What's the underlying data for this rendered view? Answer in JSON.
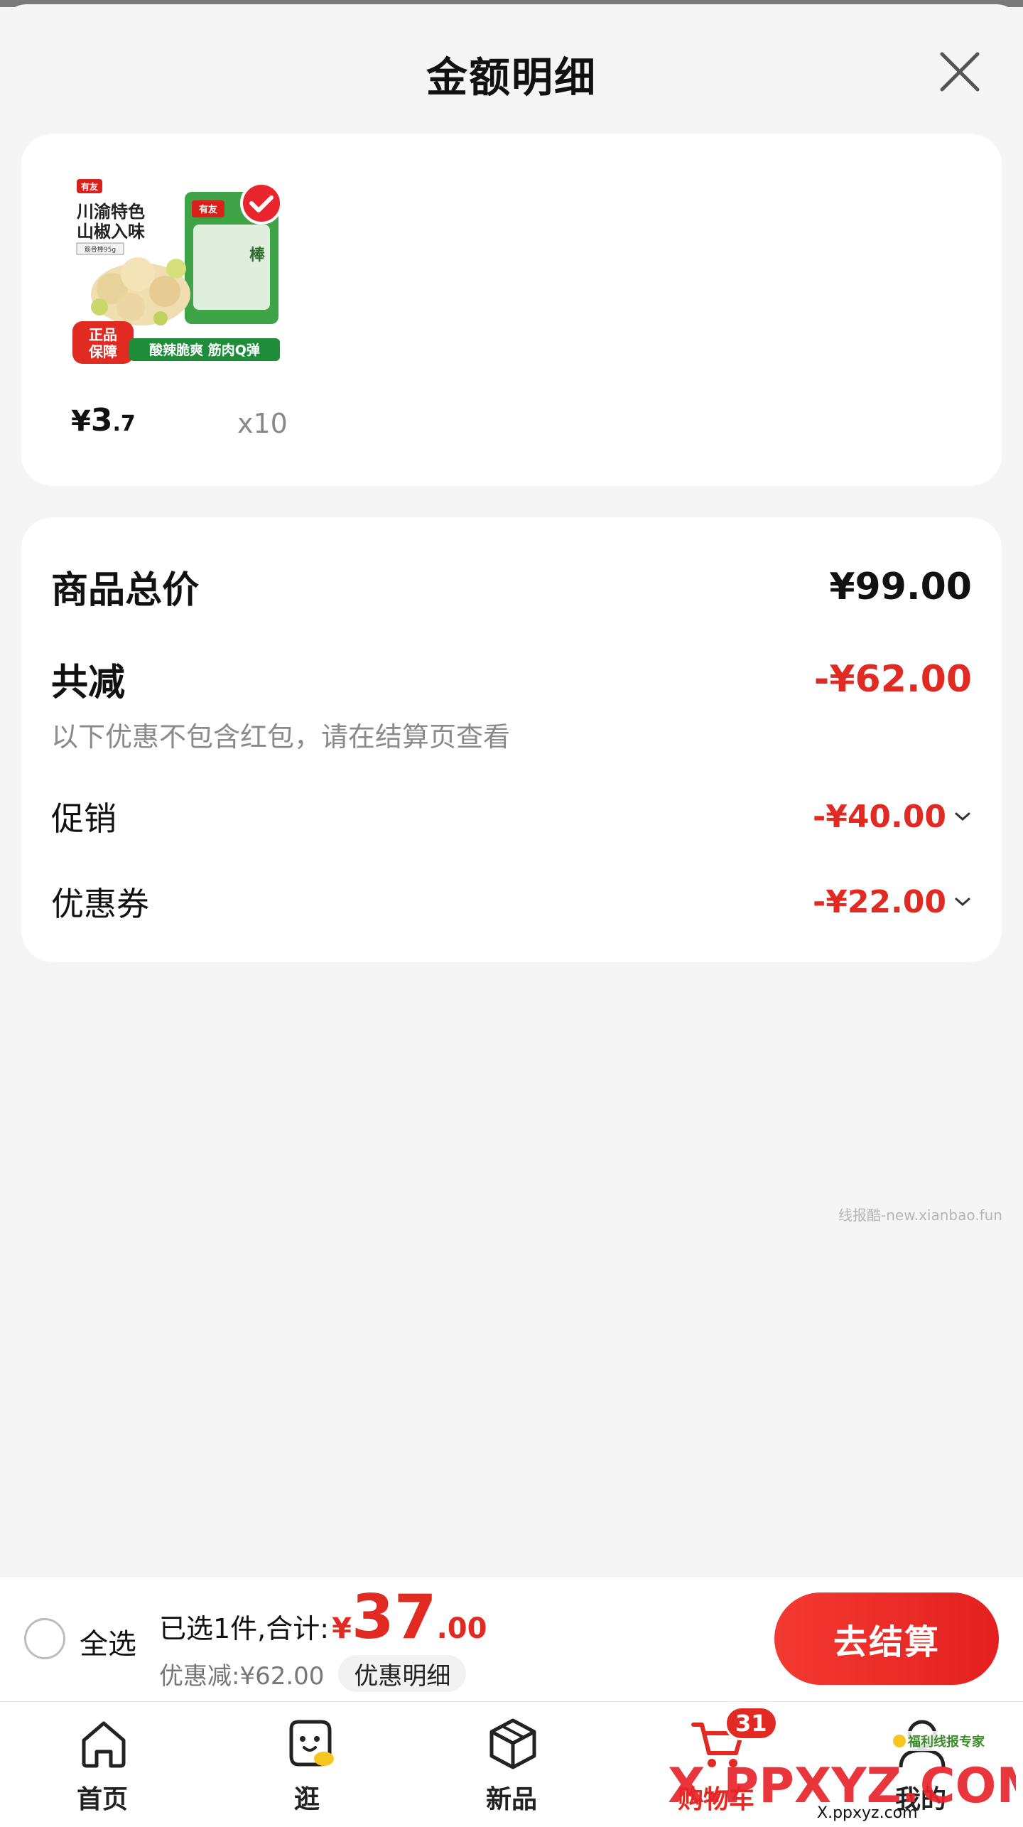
{
  "sheet": {
    "title": "金额明细"
  },
  "product": {
    "image": {
      "brand": "有友",
      "line1": "川渝特色",
      "line2": "山椒入味",
      "spec": "筋骨棒95g",
      "badge_line1": "正品",
      "badge_line2": "保障",
      "tagline": "酸辣脆爽 筋肉Q弹",
      "pack_text": "棒"
    },
    "price_symbol": "¥",
    "price_int": "3",
    "price_dec": ".7",
    "quantity": "x10"
  },
  "summary": {
    "total_label": "商品总价",
    "total_value": "¥99.00",
    "reduce_label": "共减",
    "reduce_value": "-¥62.00",
    "note": "以下优惠不包含红包，请在结算页查看",
    "promo_label": "促销",
    "promo_value": "-¥40.00",
    "coupon_label": "优惠券",
    "coupon_value": "-¥22.00"
  },
  "watermark": "线报酷-new.xianbao.fun",
  "checkout": {
    "select_all": "全选",
    "selected_text": "已选1件,合计:",
    "total_yen": "¥",
    "total_int": "37",
    "total_dec": ".00",
    "discount_text": "优惠减:¥62.00",
    "detail_chip": "优惠明细",
    "checkout_button": "去结算"
  },
  "tabs": [
    {
      "label": "首页",
      "icon": "home-icon"
    },
    {
      "label": "逛",
      "icon": "explore-icon"
    },
    {
      "label": "新品",
      "icon": "box-icon"
    },
    {
      "label": "购物车",
      "icon": "cart-icon",
      "badge": "31"
    },
    {
      "label": "我的",
      "icon": "profile-icon"
    }
  ],
  "overlay": {
    "site": "X.PPXYZ.COM",
    "site_small": "X.ppxyz.com",
    "tag": "福利线报专家"
  },
  "colors": {
    "accent_red": "#e02a22",
    "text_dark": "#111111",
    "muted": "#8a8a8a"
  }
}
